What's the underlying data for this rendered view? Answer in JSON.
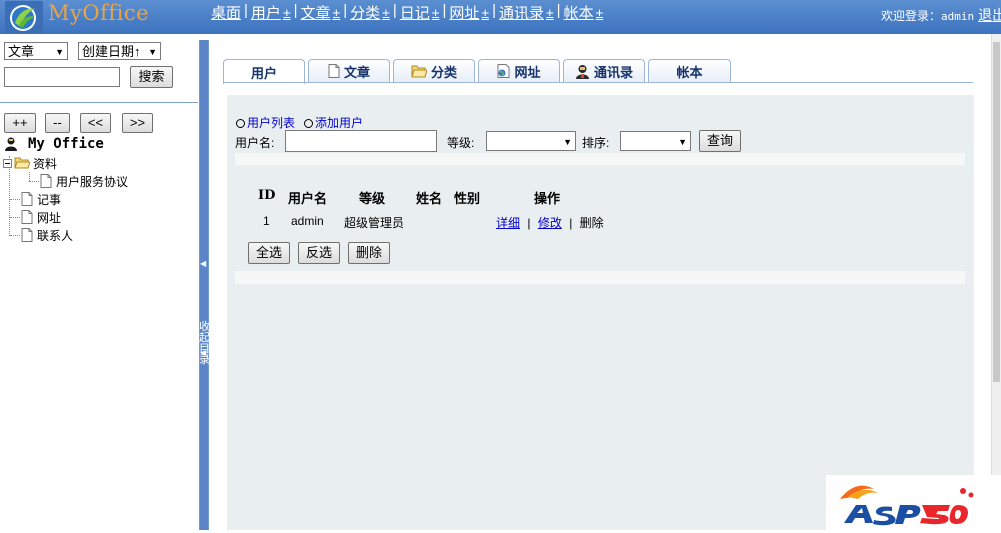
{
  "header": {
    "app_title": "MyOffice",
    "nav": [
      {
        "label": "桌面",
        "plus": ""
      },
      {
        "label": "用户",
        "plus": "±"
      },
      {
        "label": "文章",
        "plus": "±"
      },
      {
        "label": "分类",
        "plus": "±"
      },
      {
        "label": "日记",
        "plus": "±"
      },
      {
        "label": "网址",
        "plus": "±"
      },
      {
        "label": "通讯录",
        "plus": "±"
      },
      {
        "label": "帐本",
        "plus": "±"
      }
    ],
    "separator": "|",
    "welcome_label": "欢迎登录：",
    "username": "admin",
    "logout_label": "退出"
  },
  "sidebar": {
    "type_select": "文章",
    "sort_select": "创建日期↑",
    "search_button": "搜索",
    "btn_expand": "++",
    "btn_collapse": "--",
    "btn_prev": "<<",
    "btn_next": ">>",
    "tree_root": "My Office",
    "tree": {
      "folder": "资料",
      "child": "用户服务协议",
      "notes": "记事",
      "urls": "网址",
      "contacts": "联系人"
    },
    "collapse_label": "收起目录"
  },
  "tabs": [
    {
      "label": "用户",
      "icon": "none"
    },
    {
      "label": "文章",
      "icon": "document-icon"
    },
    {
      "label": "分类",
      "icon": "folder-icon"
    },
    {
      "label": "网址",
      "icon": "globe-doc-icon"
    },
    {
      "label": "通讯录",
      "icon": "contacts-icon"
    },
    {
      "label": "帐本",
      "icon": "none"
    }
  ],
  "content": {
    "link_user_list": "用户列表",
    "link_add_user": "添加用户",
    "filter": {
      "username_label": "用户名:",
      "level_label": "等级:",
      "sort_label": "排序:",
      "query_button": "查询"
    },
    "table": {
      "headers": [
        "ID",
        "用户名",
        "等级",
        "姓名",
        "性别",
        "操作"
      ],
      "rows": [
        {
          "id": "1",
          "username": "admin",
          "level": "超级管理员",
          "name": "",
          "gender": "",
          "detail": "详细",
          "edit": "修改",
          "delete": "删除"
        }
      ]
    },
    "buttons": {
      "select_all": "全选",
      "invert": "反选",
      "delete": "删除"
    }
  },
  "colors": {
    "header_bg": "#4a80c8",
    "title_orange": "#f0a33a",
    "panel_bg": "#e9eff0",
    "splitter": "#6f98d5"
  }
}
